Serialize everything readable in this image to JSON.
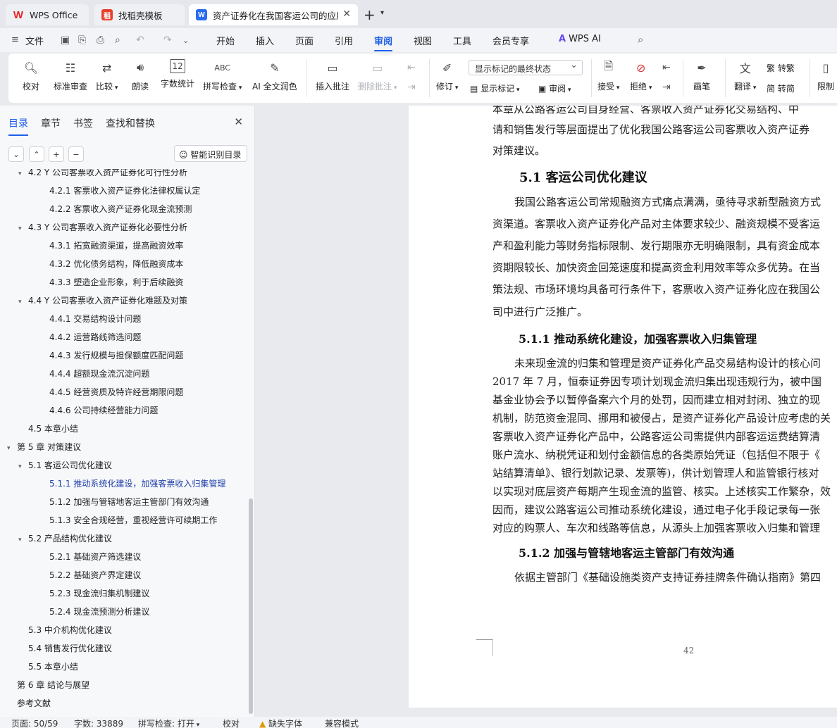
{
  "tabs": {
    "wps": "WPS Office",
    "template": "找稻壳模板",
    "document": "资产证券化在我国客运公司的应用"
  },
  "menu": {
    "file": "文件",
    "items": [
      "开始",
      "插入",
      "页面",
      "引用",
      "审阅",
      "视图",
      "工具",
      "会员专享"
    ],
    "wps_ai": "WPS AI"
  },
  "ribbon": {
    "proofread": "校对",
    "standard_review": "标准审查",
    "compare": "比较",
    "read_aloud": "朗读",
    "word_count": "字数统计",
    "spell_check": "拼写检查",
    "ai_polish": "AI 全文润色",
    "insert_comment": "插入批注",
    "delete_comment": "删除批注",
    "track_changes": "修订",
    "markup_mode": "显示标记的最终状态",
    "show_markup": "显示标记",
    "review": "审阅",
    "accept": "接受",
    "reject": "拒绝",
    "pen": "画笔",
    "translate": "翻译",
    "to_traditional": "转繁",
    "to_simplified": "转简",
    "restrict": "限制"
  },
  "sidebar": {
    "tabs": [
      "目录",
      "章节",
      "书签",
      "查找和替换"
    ],
    "smart_toc": "智能识别目录",
    "toc": [
      {
        "text": "4.2 Y 公司客票收入资产证券化可行性分析",
        "level": 2,
        "arrow": "▾"
      },
      {
        "text": "4.2.1 客票收入资产证券化法律权属认定",
        "level": 3
      },
      {
        "text": "4.2.2 客票收入资产证券化现金流预测",
        "level": 3
      },
      {
        "text": "4.3 Y 公司客票收入资产证券化必要性分析",
        "level": 2,
        "arrow": "▾"
      },
      {
        "text": "4.3.1 拓宽融资渠道，提高融资效率",
        "level": 3
      },
      {
        "text": "4.3.2 优化债务结构，降低融资成本",
        "level": 3
      },
      {
        "text": "4.3.3 塑造企业形象，利于后续融资",
        "level": 3
      },
      {
        "text": "4.4 Y 公司客票收入资产证券化难题及对策",
        "level": 2,
        "arrow": "▾"
      },
      {
        "text": "4.4.1 交易结构设计问题",
        "level": 3
      },
      {
        "text": "4.4.2 运营路线筛选问题",
        "level": 3
      },
      {
        "text": "4.4.3 发行规模与担保额度匹配问题",
        "level": 3
      },
      {
        "text": "4.4.4 超额现金流沉淀问题",
        "level": 3
      },
      {
        "text": "4.4.5 经营资质及特许经营期限问题",
        "level": 3
      },
      {
        "text": "4.4.6 公司持续经营能力问题",
        "level": 3
      },
      {
        "text": "4.5 本章小结",
        "level": 2
      },
      {
        "text": "第 5 章  对策建议",
        "level": 1,
        "arrow": "▾"
      },
      {
        "text": "5.1  客运公司优化建议",
        "level": 2,
        "arrow": "▾"
      },
      {
        "text": "5.1.1 推动系统化建设，加强客票收入归集管理",
        "level": 3,
        "current": true
      },
      {
        "text": "5.1.2 加强与管辖地客运主管部门有效沟通",
        "level": 3
      },
      {
        "text": "5.1.3 安全合规经营，重视经营许可续期工作",
        "level": 3
      },
      {
        "text": "5.2  产品结构优化建议",
        "level": 2,
        "arrow": "▾"
      },
      {
        "text": "5.2.1 基础资产筛选建议",
        "level": 3
      },
      {
        "text": "5.2.2 基础资产界定建议",
        "level": 3
      },
      {
        "text": "5.2.3 现金流归集机制建议",
        "level": 3
      },
      {
        "text": "5.2.4 现金流预测分析建议",
        "level": 3
      },
      {
        "text": "5.3 中介机构优化建议",
        "level": 2
      },
      {
        "text": "5.4 销售发行优化建议",
        "level": 2
      },
      {
        "text": "5.5 本章小结",
        "level": 2
      },
      {
        "text": "第 6 章  结论与展望",
        "level": 1
      },
      {
        "text": "参考文献",
        "level": 1
      }
    ]
  },
  "document": {
    "lines_top": [
      "本章从公路客运公司自身经营、客票收入资产证券化交易结构、中",
      "请和销售发行等层面提出了优化我国公路客运公司客票收入资产证券",
      "对策建议。"
    ],
    "h_5_1": "5.1  客运公司优化建议",
    "para_5_1": [
      "我国公路客运公司常规融资方式痛点满满，亟待寻求新型融资方式",
      "资渠道。客票收入资产证券化产品对主体要求较少、融资规模不受客运",
      "产和盈利能力等财务指标限制、发行期限亦无明确限制，具有资金成本",
      "资期限较长、加快资金回笼速度和提高资金利用效率等众多优势。在当",
      "策法规、市场环境均具备可行条件下，客票收入资产证券化应在我国公",
      "司中进行广泛推广。"
    ],
    "h_5_1_1": "5.1.1 推动系统化建设，加强客票收入归集管理",
    "para_5_1_1": [
      "未来现金流的归集和管理是资产证券化产品交易结构设计的核心问",
      "2017 年 7 月，恒泰证券因专项计划现金流归集出现违规行为，被中国",
      "基金业协会予以暂停备案六个月的处罚，因而建立相对封闭、独立的现",
      "机制，防范资金混同、挪用和被侵占，是资产证券化产品设计应考虑的关",
      "客票收入资产证券化产品中，公路客运公司需提供内部客运运费结算清",
      "账户流水、纳税凭证和划付金额信息的各类原始凭证（包括但不限于《",
      "站结算清单》、银行划款记录、发票等)，供计划管理人和监管银行核对",
      "以实现对底层资产每期产生现金流的监管、核实。上述核实工作繁杂，效",
      "因而，建议公路客运公司推动系统化建设，通过电子化手段记录每一张",
      "对应的购票人、车次和线路等信息，从源头上加强客票收入归集和管理"
    ],
    "h_5_1_2": "5.1.2 加强与管辖地客运主管部门有效沟通",
    "para_5_1_2": [
      "依据主管部门《基础设施类资产支持证券挂牌条件确认指南》第四"
    ],
    "page_number": "42"
  },
  "status": {
    "page": "页面: 50/59",
    "words": "字数: 33889",
    "spell": "拼写检查: 打开",
    "proof": "校对",
    "missing_font": "缺失字体",
    "compat": "兼容模式"
  },
  "colors": {
    "accent": "#1f5ee8",
    "doc_icon": "#2b6bf3",
    "template_icon": "#e8402c",
    "wps_red": "#e4262a"
  }
}
